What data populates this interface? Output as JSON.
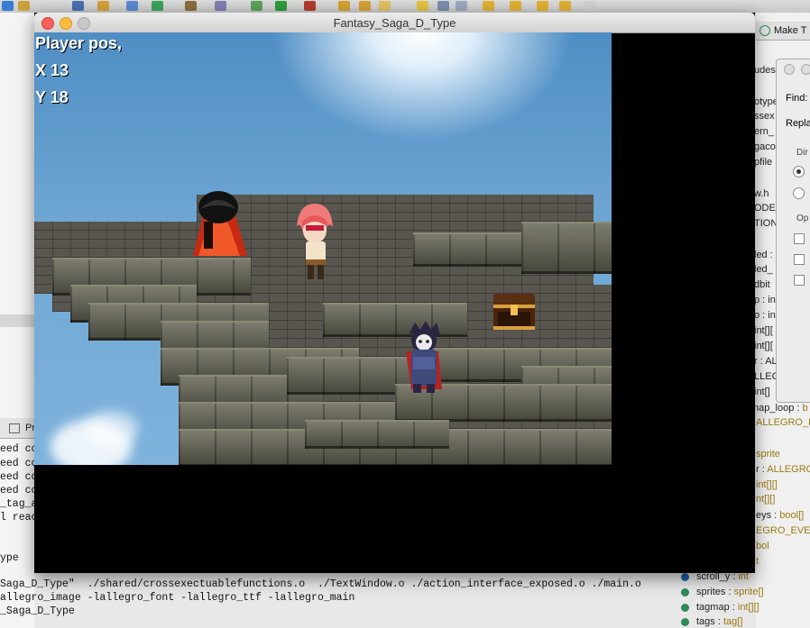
{
  "game_window": {
    "title": "Fantasy_Saga_D_Type",
    "hud": {
      "line1": "Player pos,",
      "line2": "X 13",
      "line3": "Y 18"
    },
    "sprites": [
      "mage-enemy",
      "player-red-hair",
      "knight-enemy",
      "treasure-chest"
    ]
  },
  "ide": {
    "left_tab": "Pr",
    "console_lines": [
      "eed co",
      "eed co",
      "eed co",
      "eed co",
      "_tag_a",
      "l reac",
      "ype",
      "Saga_D_Type\"  ./shared/crossexectuablefunctions.o  ./TextWindow.o ./action_interface_exposed.o ./main.o",
      "allegro_image -lallegro_font -lallegro_ttf -lallegro_main",
      "_Saga_D_Type"
    ],
    "right_tab": "Make T",
    "right_lines": [
      "udes",
      "otype",
      "ssex",
      "ern_",
      "gaco",
      "pfile",
      "",
      "w.h",
      "ODE_",
      "TION",
      "",
      "led :",
      "led_",
      "dbit",
      "p : int",
      "o : int",
      "int[][",
      "int[][",
      "r : AL",
      "LLEG",
      "int[]"
    ],
    "find_dialog": {
      "find_label": "Find:",
      "replace_label": "Repla",
      "direction_label": "Dir",
      "options_label": "Op"
    },
    "outline": [
      {
        "name": "map_loop",
        "type": "b"
      },
      {
        "name": "",
        "type": "ALLEGRO_K"
      },
      {
        "name": "",
        "type": "sprite"
      },
      {
        "name": "r",
        "type": "ALLEGRO"
      },
      {
        "name": "",
        "type": "int[][]"
      },
      {
        "name": "",
        "type": "nt[][]"
      },
      {
        "name": "eys",
        "type": "bool[]"
      },
      {
        "name": "",
        "type": "EGRO_EVE"
      },
      {
        "name": "",
        "type": "bol"
      },
      {
        "name": "",
        "type": "t"
      },
      {
        "name": "scroll_y",
        "type": "int"
      },
      {
        "name": "sprites",
        "type": "sprite[]"
      },
      {
        "name": "tagmap",
        "type": "int[][]"
      },
      {
        "name": "tags",
        "type": "tag[]"
      }
    ]
  },
  "colors": {
    "hud_text": "#ffffff",
    "window_bg": "#000000",
    "close": "#fc605c",
    "minimize": "#fdbc40",
    "zoom": "#c8c8c8"
  }
}
